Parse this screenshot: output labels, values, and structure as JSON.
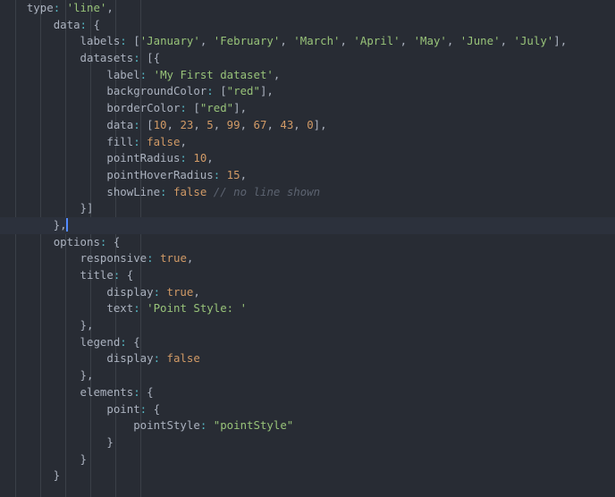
{
  "editor": {
    "theme_name": "one-dark",
    "colors": {
      "background": "#282c34",
      "active_line_background": "#2c313c",
      "foreground": "#abb2bf",
      "string": "#98c379",
      "number": "#d19a66",
      "comment": "#5c6370",
      "punctuation_colon": "#56b6c2",
      "indent_guide": "#3b4048",
      "cursor": "#528bff"
    },
    "cursor": {
      "line_index": 13,
      "column_after_text": "},"
    },
    "indent_guide_x_positions": [
      17,
      45,
      73,
      101,
      129,
      157
    ],
    "lines": [
      {
        "index": 0,
        "active": false,
        "tokens": [
          {
            "t": "    ",
            "c": "p"
          },
          {
            "t": "type",
            "c": "k"
          },
          {
            "t": ":",
            "c": "c"
          },
          {
            "t": " ",
            "c": "p"
          },
          {
            "t": "'line'",
            "c": "s"
          },
          {
            "t": ",",
            "c": "p"
          }
        ]
      },
      {
        "index": 1,
        "active": false,
        "tokens": [
          {
            "t": "        ",
            "c": "p"
          },
          {
            "t": "data",
            "c": "k"
          },
          {
            "t": ":",
            "c": "c"
          },
          {
            "t": " {",
            "c": "p"
          }
        ]
      },
      {
        "index": 2,
        "active": false,
        "tokens": [
          {
            "t": "            ",
            "c": "p"
          },
          {
            "t": "labels",
            "c": "k"
          },
          {
            "t": ":",
            "c": "c"
          },
          {
            "t": " [",
            "c": "p"
          },
          {
            "t": "'January'",
            "c": "s"
          },
          {
            "t": ", ",
            "c": "p"
          },
          {
            "t": "'February'",
            "c": "s"
          },
          {
            "t": ", ",
            "c": "p"
          },
          {
            "t": "'March'",
            "c": "s"
          },
          {
            "t": ", ",
            "c": "p"
          },
          {
            "t": "'April'",
            "c": "s"
          },
          {
            "t": ", ",
            "c": "p"
          },
          {
            "t": "'May'",
            "c": "s"
          },
          {
            "t": ", ",
            "c": "p"
          },
          {
            "t": "'June'",
            "c": "s"
          },
          {
            "t": ", ",
            "c": "p"
          },
          {
            "t": "'July'",
            "c": "s"
          },
          {
            "t": "],",
            "c": "p"
          }
        ]
      },
      {
        "index": 3,
        "active": false,
        "tokens": [
          {
            "t": "            ",
            "c": "p"
          },
          {
            "t": "datasets",
            "c": "k"
          },
          {
            "t": ":",
            "c": "c"
          },
          {
            "t": " [{",
            "c": "p"
          }
        ]
      },
      {
        "index": 4,
        "active": false,
        "tokens": [
          {
            "t": "                ",
            "c": "p"
          },
          {
            "t": "label",
            "c": "k"
          },
          {
            "t": ":",
            "c": "c"
          },
          {
            "t": " ",
            "c": "p"
          },
          {
            "t": "'My First dataset'",
            "c": "s"
          },
          {
            "t": ",",
            "c": "p"
          }
        ]
      },
      {
        "index": 5,
        "active": false,
        "tokens": [
          {
            "t": "                ",
            "c": "p"
          },
          {
            "t": "backgroundColor",
            "c": "k"
          },
          {
            "t": ":",
            "c": "c"
          },
          {
            "t": " [",
            "c": "p"
          },
          {
            "t": "\"red\"",
            "c": "s"
          },
          {
            "t": "],",
            "c": "p"
          }
        ]
      },
      {
        "index": 6,
        "active": false,
        "tokens": [
          {
            "t": "                ",
            "c": "p"
          },
          {
            "t": "borderColor",
            "c": "k"
          },
          {
            "t": ":",
            "c": "c"
          },
          {
            "t": " [",
            "c": "p"
          },
          {
            "t": "\"red\"",
            "c": "s"
          },
          {
            "t": "],",
            "c": "p"
          }
        ]
      },
      {
        "index": 7,
        "active": false,
        "tokens": [
          {
            "t": "                ",
            "c": "p"
          },
          {
            "t": "data",
            "c": "k"
          },
          {
            "t": ":",
            "c": "c"
          },
          {
            "t": " [",
            "c": "p"
          },
          {
            "t": "10",
            "c": "n"
          },
          {
            "t": ", ",
            "c": "p"
          },
          {
            "t": "23",
            "c": "n"
          },
          {
            "t": ", ",
            "c": "p"
          },
          {
            "t": "5",
            "c": "n"
          },
          {
            "t": ", ",
            "c": "p"
          },
          {
            "t": "99",
            "c": "n"
          },
          {
            "t": ", ",
            "c": "p"
          },
          {
            "t": "67",
            "c": "n"
          },
          {
            "t": ", ",
            "c": "p"
          },
          {
            "t": "43",
            "c": "n"
          },
          {
            "t": ", ",
            "c": "p"
          },
          {
            "t": "0",
            "c": "n"
          },
          {
            "t": "],",
            "c": "p"
          }
        ]
      },
      {
        "index": 8,
        "active": false,
        "tokens": [
          {
            "t": "                ",
            "c": "p"
          },
          {
            "t": "fill",
            "c": "k"
          },
          {
            "t": ":",
            "c": "c"
          },
          {
            "t": " ",
            "c": "p"
          },
          {
            "t": "false",
            "c": "n"
          },
          {
            "t": ",",
            "c": "p"
          }
        ]
      },
      {
        "index": 9,
        "active": false,
        "tokens": [
          {
            "t": "                ",
            "c": "p"
          },
          {
            "t": "pointRadius",
            "c": "k"
          },
          {
            "t": ":",
            "c": "c"
          },
          {
            "t": " ",
            "c": "p"
          },
          {
            "t": "10",
            "c": "n"
          },
          {
            "t": ",",
            "c": "p"
          }
        ]
      },
      {
        "index": 10,
        "active": false,
        "tokens": [
          {
            "t": "                ",
            "c": "p"
          },
          {
            "t": "pointHoverRadius",
            "c": "k"
          },
          {
            "t": ":",
            "c": "c"
          },
          {
            "t": " ",
            "c": "p"
          },
          {
            "t": "15",
            "c": "n"
          },
          {
            "t": ",",
            "c": "p"
          }
        ]
      },
      {
        "index": 11,
        "active": false,
        "tokens": [
          {
            "t": "                ",
            "c": "p"
          },
          {
            "t": "showLine",
            "c": "k"
          },
          {
            "t": ":",
            "c": "c"
          },
          {
            "t": " ",
            "c": "p"
          },
          {
            "t": "false",
            "c": "n"
          },
          {
            "t": " ",
            "c": "p"
          },
          {
            "t": "// no line shown",
            "c": "cm"
          }
        ]
      },
      {
        "index": 12,
        "active": false,
        "tokens": [
          {
            "t": "            }]",
            "c": "p"
          }
        ]
      },
      {
        "index": 13,
        "active": true,
        "cursor": true,
        "tokens": [
          {
            "t": "        },",
            "c": "p"
          }
        ]
      },
      {
        "index": 14,
        "active": false,
        "tokens": [
          {
            "t": "        ",
            "c": "p"
          },
          {
            "t": "options",
            "c": "k"
          },
          {
            "t": ":",
            "c": "c"
          },
          {
            "t": " {",
            "c": "p"
          }
        ]
      },
      {
        "index": 15,
        "active": false,
        "tokens": [
          {
            "t": "            ",
            "c": "p"
          },
          {
            "t": "responsive",
            "c": "k"
          },
          {
            "t": ":",
            "c": "c"
          },
          {
            "t": " ",
            "c": "p"
          },
          {
            "t": "true",
            "c": "n"
          },
          {
            "t": ",",
            "c": "p"
          }
        ]
      },
      {
        "index": 16,
        "active": false,
        "tokens": [
          {
            "t": "            ",
            "c": "p"
          },
          {
            "t": "title",
            "c": "k"
          },
          {
            "t": ":",
            "c": "c"
          },
          {
            "t": " {",
            "c": "p"
          }
        ]
      },
      {
        "index": 17,
        "active": false,
        "tokens": [
          {
            "t": "                ",
            "c": "p"
          },
          {
            "t": "display",
            "c": "k"
          },
          {
            "t": ":",
            "c": "c"
          },
          {
            "t": " ",
            "c": "p"
          },
          {
            "t": "true",
            "c": "n"
          },
          {
            "t": ",",
            "c": "p"
          }
        ]
      },
      {
        "index": 18,
        "active": false,
        "tokens": [
          {
            "t": "                ",
            "c": "p"
          },
          {
            "t": "text",
            "c": "k"
          },
          {
            "t": ":",
            "c": "c"
          },
          {
            "t": " ",
            "c": "p"
          },
          {
            "t": "'Point Style: '",
            "c": "s"
          }
        ]
      },
      {
        "index": 19,
        "active": false,
        "tokens": [
          {
            "t": "            },",
            "c": "p"
          }
        ]
      },
      {
        "index": 20,
        "active": false,
        "tokens": [
          {
            "t": "            ",
            "c": "p"
          },
          {
            "t": "legend",
            "c": "k"
          },
          {
            "t": ":",
            "c": "c"
          },
          {
            "t": " {",
            "c": "p"
          }
        ]
      },
      {
        "index": 21,
        "active": false,
        "tokens": [
          {
            "t": "                ",
            "c": "p"
          },
          {
            "t": "display",
            "c": "k"
          },
          {
            "t": ":",
            "c": "c"
          },
          {
            "t": " ",
            "c": "p"
          },
          {
            "t": "false",
            "c": "n"
          }
        ]
      },
      {
        "index": 22,
        "active": false,
        "tokens": [
          {
            "t": "            },",
            "c": "p"
          }
        ]
      },
      {
        "index": 23,
        "active": false,
        "tokens": [
          {
            "t": "            ",
            "c": "p"
          },
          {
            "t": "elements",
            "c": "k"
          },
          {
            "t": ":",
            "c": "c"
          },
          {
            "t": " {",
            "c": "p"
          }
        ]
      },
      {
        "index": 24,
        "active": false,
        "tokens": [
          {
            "t": "                ",
            "c": "p"
          },
          {
            "t": "point",
            "c": "k"
          },
          {
            "t": ":",
            "c": "c"
          },
          {
            "t": " {",
            "c": "p"
          }
        ]
      },
      {
        "index": 25,
        "active": false,
        "tokens": [
          {
            "t": "                    ",
            "c": "p"
          },
          {
            "t": "pointStyle",
            "c": "k"
          },
          {
            "t": ":",
            "c": "c"
          },
          {
            "t": " ",
            "c": "p"
          },
          {
            "t": "\"pointStyle\"",
            "c": "s"
          }
        ]
      },
      {
        "index": 26,
        "active": false,
        "tokens": [
          {
            "t": "                }",
            "c": "p"
          }
        ]
      },
      {
        "index": 27,
        "active": false,
        "tokens": [
          {
            "t": "            }",
            "c": "p"
          }
        ]
      },
      {
        "index": 28,
        "active": false,
        "tokens": [
          {
            "t": "        }",
            "c": "p"
          }
        ]
      }
    ]
  }
}
